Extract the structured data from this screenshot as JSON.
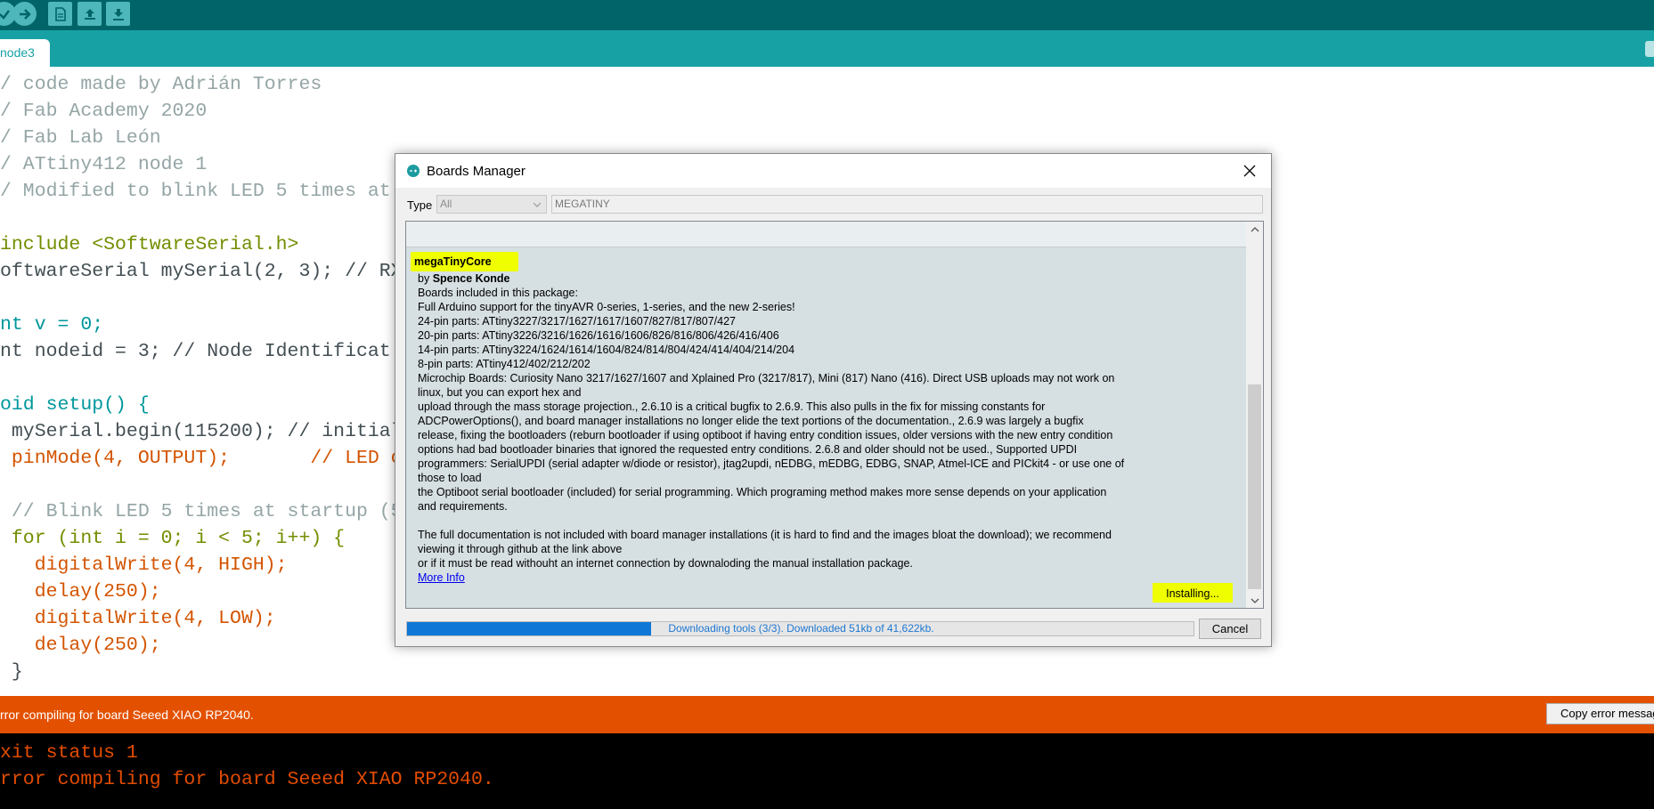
{
  "toolbar": {
    "buttons": [
      {
        "name": "verify-icon"
      },
      {
        "name": "upload-icon"
      },
      {
        "name": "new-file-icon"
      },
      {
        "name": "open-file-icon"
      },
      {
        "name": "save-file-icon"
      }
    ]
  },
  "tabs": {
    "active_label": "node3"
  },
  "editor": {
    "lines": [
      "/ code made by Adrián Torres",
      "/ Fab Academy 2020",
      "/ Fab Lab León",
      "/ ATtiny412 node 1",
      "/ Modified to blink LED 5 times at",
      "",
      "include <SoftwareSerial.h>",
      "oftwareSerial mySerial(2, 3); // RX",
      "",
      "nt v = 0;",
      "nt nodeid = 3; // Node Identificat",
      "",
      "oid setup() {",
      " mySerial.begin(115200); // initial",
      " pinMode(4, OUTPUT);       // LED on",
      "",
      " // Blink LED 5 times at startup (5",
      " for (int i = 0; i < 5; i++) {",
      "   digitalWrite(4, HIGH);",
      "   delay(250);",
      "   digitalWrite(4, LOW);",
      "   delay(250);",
      " }"
    ]
  },
  "status": {
    "message": "rror compiling for board Seeed XIAO RP2040.",
    "copy_button": "Copy error messages"
  },
  "console": {
    "lines": [
      "xit status 1",
      "rror compiling for board Seeed XIAO RP2040."
    ]
  },
  "dialog": {
    "title": "Boards Manager",
    "type_label": "Type",
    "type_value": "All",
    "search_value": "MEGATINY",
    "item": {
      "name": "megaTinyCore",
      "by_prefix": "by ",
      "author": "Spence Konde",
      "lines": [
        "Boards included in this package:",
        "Full Arduino support for the tinyAVR 0-series, 1-series, and the new 2-series!",
        "24-pin parts: ATtiny3227/3217/1627/1617/1607/827/817/807/427",
        "20-pin parts: ATtiny3226/3216/1626/1616/1606/826/816/806/426/416/406",
        "14-pin parts: ATtiny3224/1624/1614/1604/824/814/804/424/414/404/214/204",
        "8-pin parts: ATtiny412/402/212/202",
        "Microchip Boards: Curiosity Nano 3217/1627/1607 and Xplained Pro (3217/817), Mini (817) Nano (416). Direct USB uploads may not work on",
        "linux, but you can export hex and",
        "upload through the mass storage projection., 2.6.10 is a critical bugfix to 2.6.9. This also pulls in the fix for missing constants for",
        "ADCPowerOptions(), and board manager installations no longer elide the text portions of the documentation., 2.6.9 was largely a bugfix",
        "release, fixing the bootloaders (reburn bootloader if using optiboot if having entry condition issues, older versions with the new entry condition",
        "options had bad bootloader binaries that ignored the requested entry conditions. 2.6.8 and older should not be used., Supported UPDI",
        "programmers: SerialUPDI (serial adapter w/diode or resistor), jtag2updi, nEDBG, mEDBG, EDBG, SNAP, Atmel-ICE and PICkit4 - or use one of",
        "those to load",
        "the Optiboot serial bootloader (included) for serial programming. Which programing method makes more sense depends on your application",
        "and requirements.",
        "",
        "The full documentation is not included with board manager installations (it is hard to find and the images bloat the download); we recommend",
        "viewing it through github at the link above",
        "or if it must be read withouht an internet connection by downaloding the manual installation package."
      ],
      "more_info": "More Info",
      "install_status": "Installing..."
    },
    "progress": {
      "text": "Downloading tools (3/3). Downloaded 51kb of 41,622kb.",
      "fraction": 0.31
    },
    "cancel_label": "Cancel"
  },
  "colors": {
    "toolbar": "#006468",
    "tabbar": "#17a1a5",
    "error_bar": "#e35100",
    "highlight": "#f0ff00",
    "progress": "#0f78d6"
  }
}
